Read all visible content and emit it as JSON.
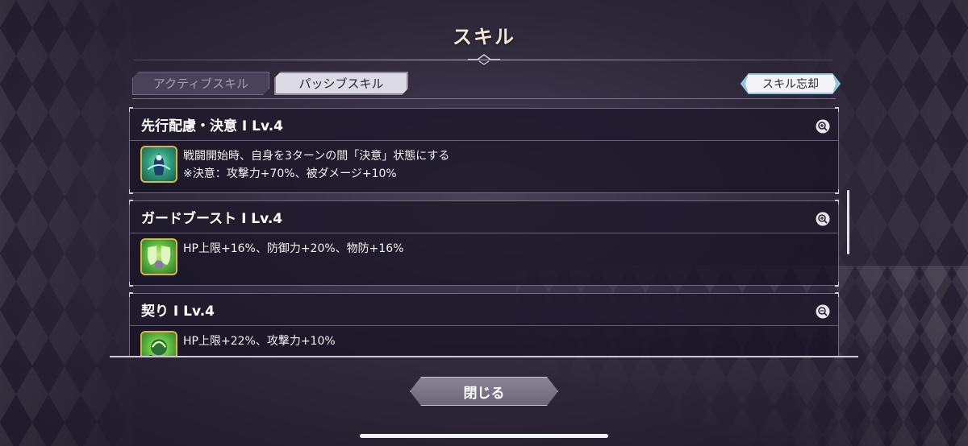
{
  "header": {
    "title": "スキル"
  },
  "tabs": [
    {
      "label": "アクティブスキル",
      "active": false
    },
    {
      "label": "パッシブスキル",
      "active": true
    }
  ],
  "forget_button": {
    "label": "スキル忘却"
  },
  "skills": [
    {
      "name": "先行配慮・決意 I  Lv.4",
      "icon": "warrior-aura-icon",
      "line1": "戦闘開始時、自身を3ターンの間「決意」状態にする",
      "line2": "※決意：攻撃力+70%、被ダメージ+10%"
    },
    {
      "name": "ガードブースト I  Lv.4",
      "icon": "shield-guard-icon",
      "line1": "HP上限+16%、防御力+20%、物防+16%",
      "line2": ""
    },
    {
      "name": "契り I  Lv.4",
      "icon": "pact-icon",
      "line1": "HP上限+22%、攻撃力+10%",
      "line2": ""
    }
  ],
  "close_button": {
    "label": "閉じる"
  },
  "colors": {
    "accent": "#8ec6e8",
    "title": "#f3ead6",
    "panel": "#16122299"
  }
}
